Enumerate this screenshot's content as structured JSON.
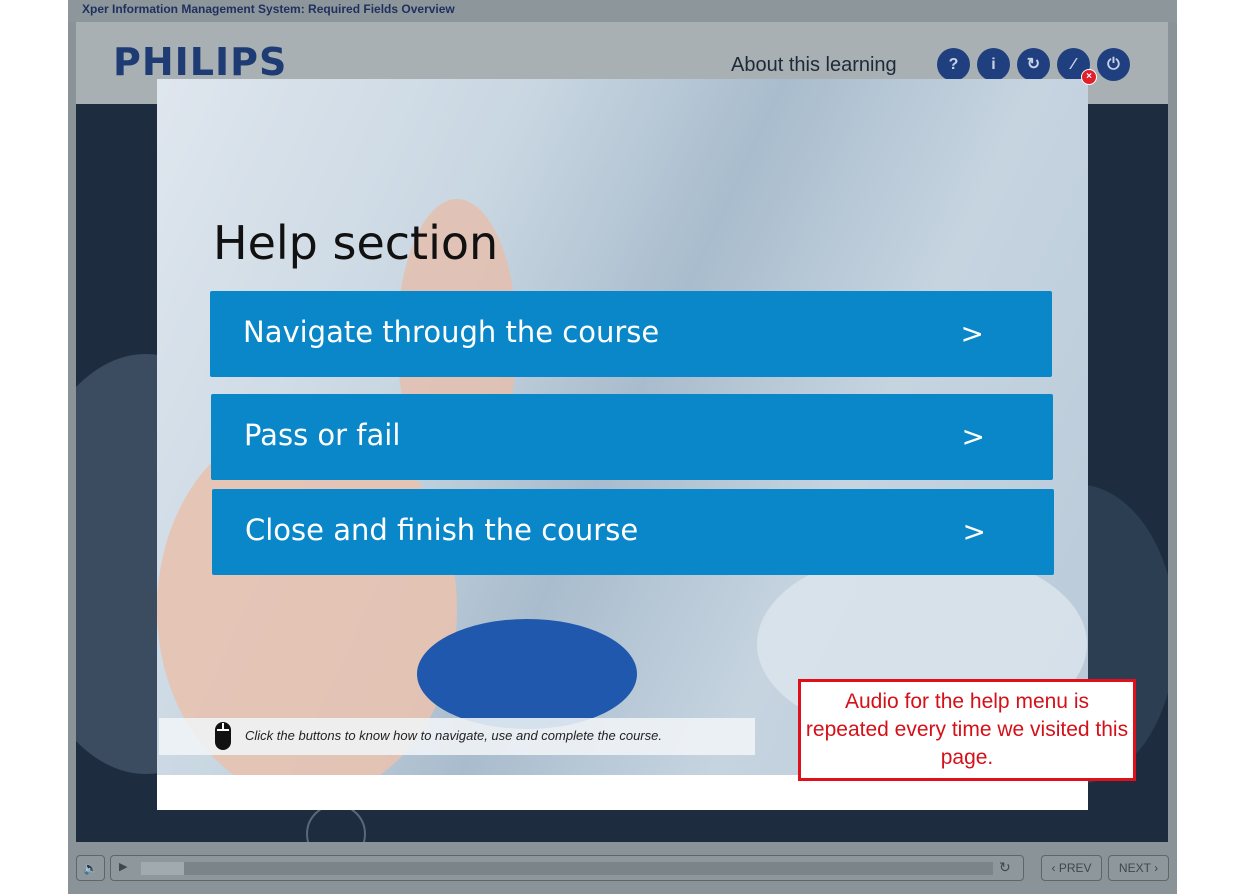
{
  "window": {
    "title": "Xper Information Management System: Required Fields Overview"
  },
  "header": {
    "logo": "PHILIPS",
    "about_label": "About this learning",
    "icons": [
      {
        "name": "help-icon",
        "glyph": "?"
      },
      {
        "name": "info-icon",
        "glyph": "i"
      },
      {
        "name": "replay-icon",
        "glyph": "↻"
      },
      {
        "name": "glossary-icon",
        "glyph": "⁄"
      },
      {
        "name": "power-icon",
        "glyph": "⏻"
      }
    ]
  },
  "modal": {
    "close_glyph": "×",
    "title": "Help section",
    "buttons": [
      {
        "label": "Navigate through the course",
        "chevron": ">"
      },
      {
        "label": "Pass or fail",
        "chevron": ">"
      },
      {
        "label": "Close and finish the course",
        "chevron": ">"
      }
    ],
    "hint": "Click the buttons to know how to navigate, use and complete the course."
  },
  "footer": {
    "mute_glyph": "🔈",
    "play_glyph": "▶",
    "progress_fraction": 0.05,
    "replay_glyph": "↻",
    "prev_label": "PREV",
    "next_label": "NEXT",
    "prev_chevron": "‹",
    "next_chevron": "›"
  },
  "annotation": {
    "text": "Audio for the help menu is repeated every time we visited this page."
  },
  "colors": {
    "accent": "#0a87c8",
    "brand": "#1e3c73",
    "annotation": "#e0101a"
  }
}
